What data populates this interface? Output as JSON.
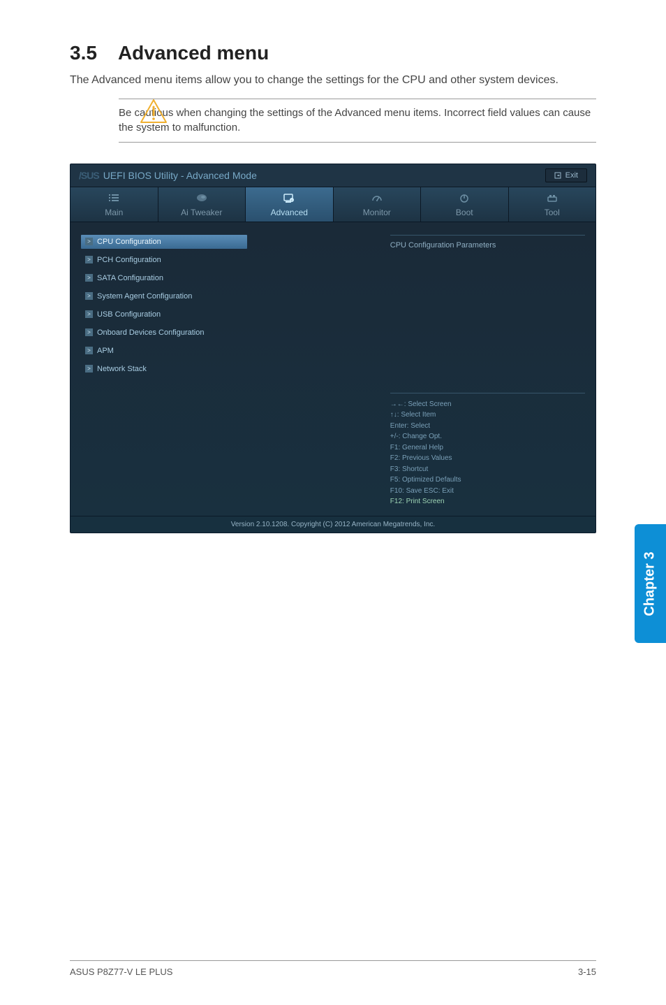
{
  "section": {
    "number": "3.5",
    "title": "Advanced menu",
    "description": "The Advanced menu items allow you to change the settings for the CPU and other system devices.",
    "warning": "Be cautious when changing the settings of the Advanced menu items. Incorrect field values can cause the system to malfunction."
  },
  "bios": {
    "brand": "/SUS",
    "utility_title": "UEFI BIOS Utility - Advanced Mode",
    "exit_label": "Exit",
    "tabs": [
      "Main",
      "Ai  Tweaker",
      "Advanced",
      "Monitor",
      "Boot",
      "Tool"
    ],
    "active_tab_index": 2,
    "menu_items": [
      "CPU Configuration",
      "PCH Configuration",
      "SATA Configuration",
      "System Agent Configuration",
      "USB Configuration",
      "Onboard Devices Configuration",
      "APM",
      "Network Stack"
    ],
    "selected_menu_index": 0,
    "info_title": "CPU Configuration Parameters",
    "hints": [
      "→←:  Select Screen",
      "↑↓:  Select Item",
      "Enter:  Select",
      "+/-:  Change Opt.",
      "F1:  General Help",
      "F2:  Previous Values",
      "F3:  Shortcut",
      "F5:  Optimized Defaults",
      "F10:  Save   ESC:  Exit",
      "F12: Print Screen"
    ],
    "highlight_hint_index": 9,
    "footer": "Version  2.10.1208.   Copyright  (C)  2012  American  Megatrends,  Inc."
  },
  "sidetab": "Chapter 3",
  "page_footer": {
    "left": "ASUS P8Z77-V LE PLUS",
    "right": "3-15"
  }
}
